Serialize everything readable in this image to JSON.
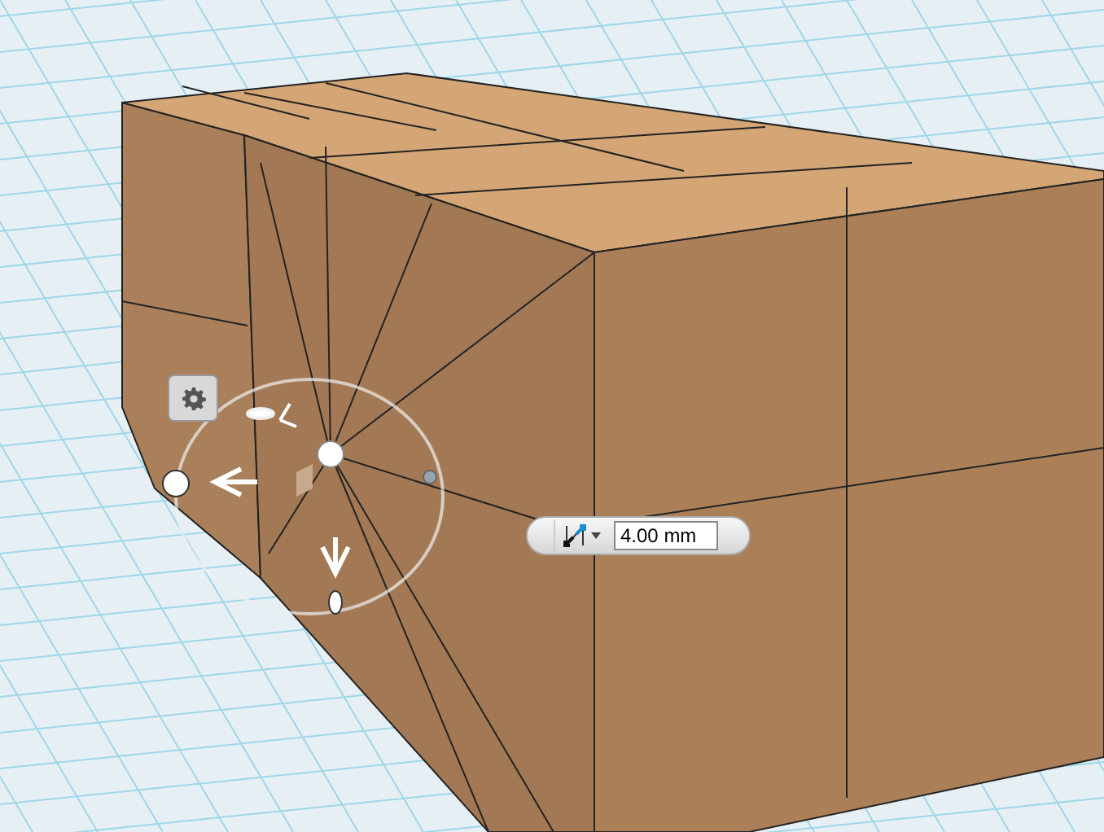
{
  "dimension_input": {
    "value": "4.00 mm"
  }
}
